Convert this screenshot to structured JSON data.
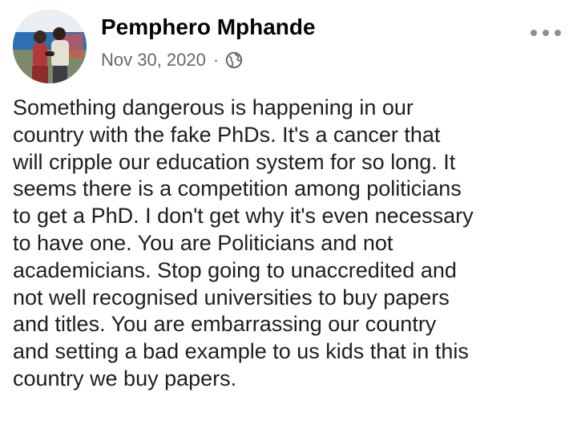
{
  "post": {
    "author": {
      "name": "Pemphero Mphande",
      "avatar_icon": "profile-photo"
    },
    "meta": {
      "date": "Nov 30, 2020",
      "separator": "·",
      "audience_icon": "globe-icon"
    },
    "more_icon": "more-options-icon",
    "body": "Something dangerous is happening in our\ncountry with the fake PhDs. It's a cancer that\nwill cripple our education system for so long. It\nseems there is a competition among politicians\nto get a PhD. I don't get why it's even necessary\nto have one. You are Politicians and not\nacademicians. Stop going to unaccredited and\nnot well recognised universities to buy papers\nand titles. You are embarrassing our country\nand setting a bad example to us kids that in this\ncountry we buy papers."
  },
  "colors": {
    "text_primary": "#050505",
    "text_body": "#1c1e21",
    "text_secondary": "#65676b",
    "icon_gray": "#8a8d91",
    "background": "#ffffff"
  }
}
